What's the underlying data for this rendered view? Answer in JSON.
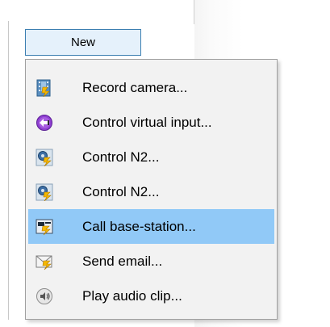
{
  "toolbar": {
    "new_button_label": "New"
  },
  "menu": {
    "items": [
      {
        "label": "Record camera...",
        "icon": "record-camera-icon"
      },
      {
        "label": "Control virtual input...",
        "icon": "virtual-input-icon"
      },
      {
        "label": "Control N2...",
        "icon": "control-n2-icon"
      },
      {
        "label": "Control N2...",
        "icon": "control-n2-icon"
      },
      {
        "label": "Call base-station...",
        "icon": "call-base-station-icon",
        "selected": true
      },
      {
        "label": "Send email...",
        "icon": "send-email-icon"
      },
      {
        "label": "Play audio clip...",
        "icon": "audio-clip-icon"
      }
    ]
  },
  "colors": {
    "button_bg": "#e5f1fb",
    "button_border": "#3c7fb1",
    "menu_bg": "#f2f2f2",
    "selection": "#91c9f7"
  }
}
